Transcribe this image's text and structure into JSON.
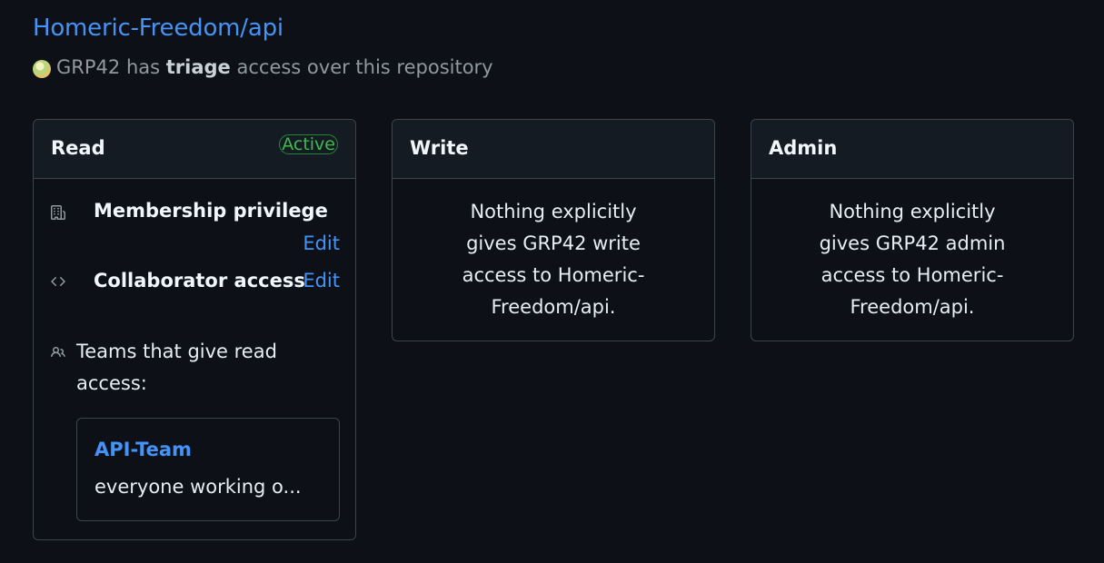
{
  "header": {
    "repo_link": "Homeric-Freedom/api",
    "subtitle_group": "GRP42",
    "subtitle_has": "has",
    "subtitle_role": "triage",
    "subtitle_rest": "access over this repository"
  },
  "cards": {
    "read": {
      "title": "Read",
      "badge": "Active",
      "membership": {
        "label": "Membership privilege",
        "edit": "Edit",
        "icon": "organization-icon"
      },
      "collaborator": {
        "label": "Collaborator access",
        "edit": "Edit",
        "icon": "code-icon"
      },
      "teams": {
        "label": "Teams that give read access:",
        "icon": "people-icon"
      },
      "team": {
        "name": "API-Team",
        "description": "everyone working o..."
      }
    },
    "write": {
      "title": "Write",
      "message": "Nothing explicitly gives GRP42 write access to Homeric-Freedom/api."
    },
    "admin": {
      "title": "Admin",
      "message": "Nothing explicitly gives GRP42 admin access to Homeric-Freedom/api."
    }
  },
  "colors": {
    "background": "#0d1117",
    "link": "#4493f8",
    "active": "#3fb950",
    "border": "#3d444d"
  }
}
